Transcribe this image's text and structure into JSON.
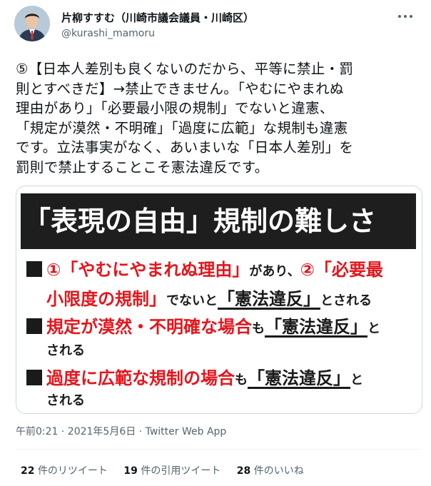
{
  "author": {
    "name": "片柳すすむ（川崎市議会議員・川崎区）",
    "handle": "@kurashi_mamoru"
  },
  "tweet": {
    "lines": [
      "⑤【日本人差別も良くないのだから、平等に禁止・罰",
      "則とすべきだ】→禁止できません。「やむにやまれぬ",
      "理由があり」「必要最小限の規制」でないと違憲、",
      "「規定が漠然・不明確」「過度に広範」な規制も違憲",
      "です。立法事実がなく、あいまいな「日本人差別」を",
      "罰則で禁止することこそ憲法違反です。"
    ]
  },
  "slide": {
    "title": "「表現の自由」規制の難しさ",
    "line1": {
      "red1": "①「やむにやまれぬ理由」",
      "small1": "があり、",
      "red2": "②「必要最"
    },
    "line2": {
      "red": "小限度の規制」",
      "small1": "でないと",
      "under": "「憲法違反」",
      "small2": "とされる"
    },
    "line3": {
      "red": "規定が漠然・不明確な場合",
      "small1": "も",
      "under": "「憲法違反」",
      "small2": "と"
    },
    "line4": {
      "small": "される"
    },
    "line5": {
      "red": "過度に広範な規制の場合",
      "small1": "も",
      "under": "「憲法違反」",
      "small2": "と"
    },
    "line6": {
      "small": "される"
    }
  },
  "meta": {
    "time": "午前0:21 · 2021年5月6日 · ",
    "app": "Twitter Web App"
  },
  "stats": {
    "retweets_count": "22",
    "retweets_label": "件のリツイート",
    "quotes_count": "19",
    "quotes_label": "件の引用ツイート",
    "likes_count": "28",
    "likes_label": "件のいいね"
  },
  "colors": {
    "accent_red": "#e8141b",
    "text": "#0f1419",
    "muted": "#536471",
    "banner": "#1e1e1e"
  }
}
